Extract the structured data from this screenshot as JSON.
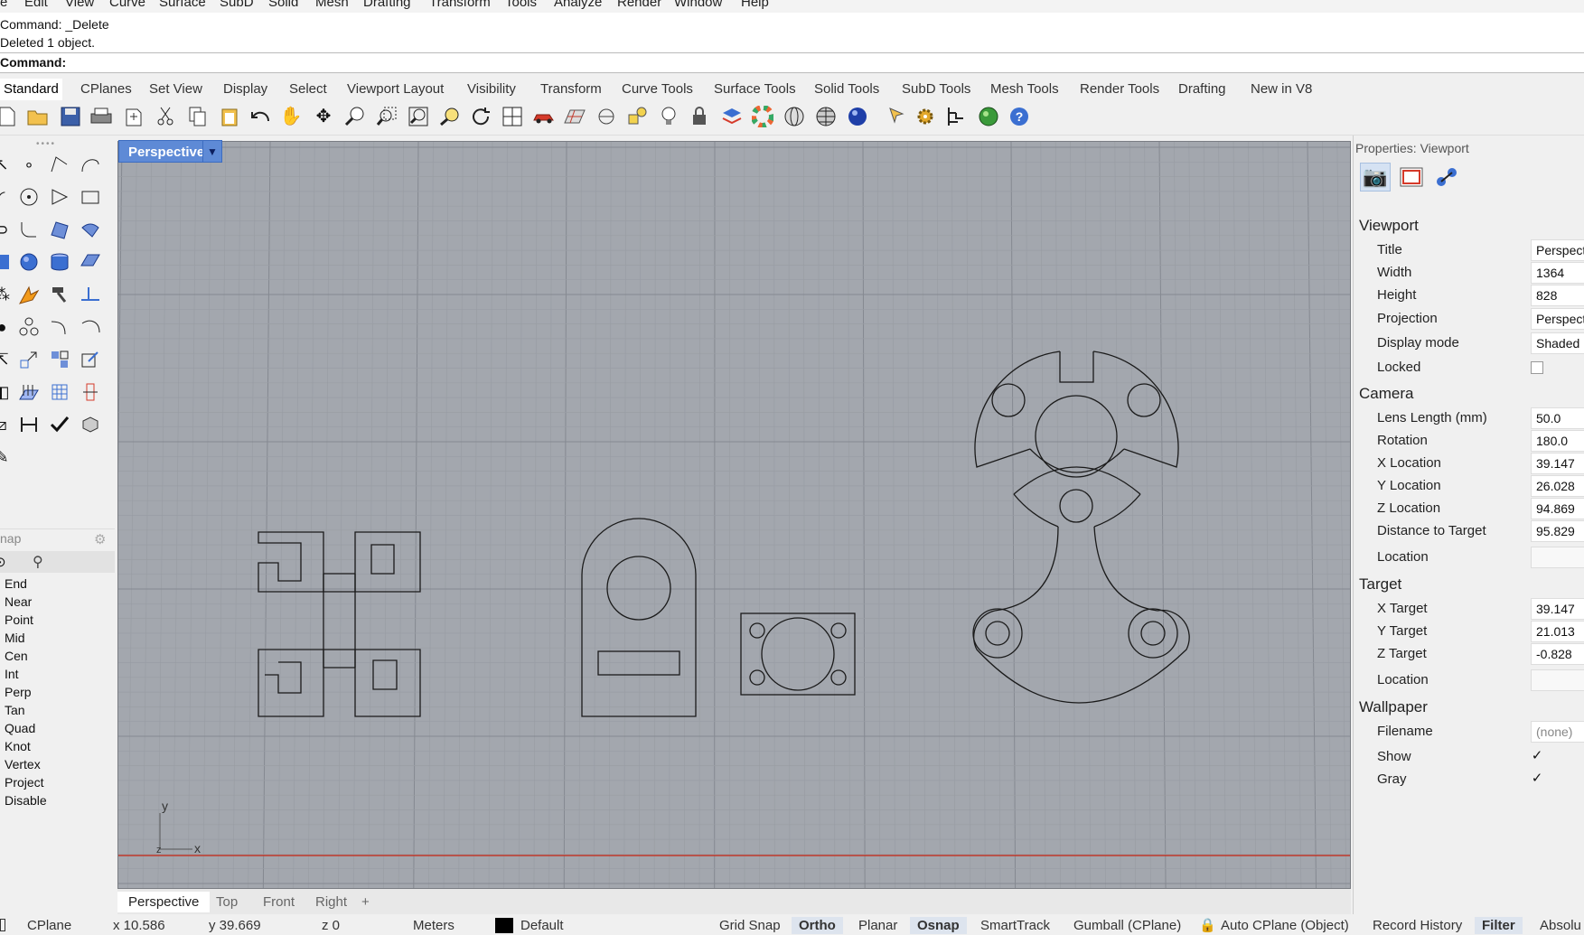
{
  "menu": [
    "e",
    "Edit",
    "View",
    "Curve",
    "Surface",
    "SubD",
    "Solid",
    "Mesh",
    "Drafting",
    "Transform",
    "Tools",
    "Analyze",
    "Render",
    "Window",
    "Help"
  ],
  "command_history": [
    "Command: _Delete",
    "Deleted 1 object."
  ],
  "command_prompt": "Command:",
  "toolbar_tabs": [
    "Standard",
    "CPlanes",
    "Set View",
    "Display",
    "Select",
    "Viewport Layout",
    "Visibility",
    "Transform",
    "Curve Tools",
    "Surface Tools",
    "Solid Tools",
    "SubD Tools",
    "Mesh Tools",
    "Render Tools",
    "Drafting",
    "New in V8"
  ],
  "toolbar_icons": [
    "new-icon",
    "open-icon",
    "save-icon",
    "print-icon",
    "import-icon",
    "cut-icon",
    "copy-icon",
    "paste-icon",
    "undo-icon",
    "pan-hand-icon",
    "move-view-icon",
    "zoom-icon",
    "zoom-window-icon",
    "zoom-extents-icon",
    "zoom-selected-icon",
    "rotate-view-icon",
    "four-viewports-icon",
    "car-icon",
    "grid-icon",
    "cplane-icon",
    "shape-icon",
    "light-icon",
    "lock-icon",
    "layer-icon",
    "color-wheel-icon",
    "sphere-wire-icon",
    "mesh-sphere-icon",
    "render-sphere-icon",
    "pointer-icon",
    "gear-icon",
    "tree-icon",
    "globe-icon",
    "help-icon"
  ],
  "osnap": {
    "title": "nap",
    "items": [
      "End",
      "Near",
      "Point",
      "Mid",
      "Cen",
      "Int",
      "Perp",
      "Tan",
      "Quad",
      "Knot",
      "Vertex",
      "Project",
      "Disable"
    ]
  },
  "viewport": {
    "label": "Perspective",
    "axis_x": "x",
    "axis_y": "y",
    "axis_z": "z"
  },
  "viewport_tabs": [
    "Perspective",
    "Top",
    "Front",
    "Right",
    "+"
  ],
  "status": {
    "cplane": "CPlane",
    "x": "x 10.586",
    "y": "y 39.669",
    "z": "z 0",
    "units": "Meters",
    "layer": "Default",
    "grid_snap": "Grid Snap",
    "ortho": "Ortho",
    "planar": "Planar",
    "osnap": "Osnap",
    "smarttrack": "SmartTrack",
    "gumball": "Gumball (CPlane)",
    "autocplane": "Auto CPlane (Object)",
    "record_history": "Record History",
    "filter": "Filter",
    "absolute": "Absolu"
  },
  "properties": {
    "title": "Properties: Viewport",
    "viewport_section": "Viewport",
    "camera_section": "Camera",
    "target_section": "Target",
    "wallpaper_section": "Wallpaper",
    "viewport": [
      {
        "label": "Title",
        "value": "Perspect"
      },
      {
        "label": "Width",
        "value": "1364"
      },
      {
        "label": "Height",
        "value": "828"
      },
      {
        "label": "Projection",
        "value": "Perspect"
      },
      {
        "label": "Display mode",
        "value": "Shaded"
      },
      {
        "label": "Locked",
        "value": ""
      }
    ],
    "camera": [
      {
        "label": "Lens Length (mm)",
        "value": "50.0"
      },
      {
        "label": "Rotation",
        "value": "180.0"
      },
      {
        "label": "X Location",
        "value": "39.147"
      },
      {
        "label": "Y Location",
        "value": "26.028"
      },
      {
        "label": "Z Location",
        "value": "94.869"
      },
      {
        "label": "Distance to Target",
        "value": "95.829"
      },
      {
        "label": "Location",
        "value": ""
      }
    ],
    "target": [
      {
        "label": "X Target",
        "value": "39.147"
      },
      {
        "label": "Y Target",
        "value": "21.013"
      },
      {
        "label": "Z Target",
        "value": "-0.828"
      },
      {
        "label": "Location",
        "value": ""
      }
    ],
    "wallpaper": [
      {
        "label": "Filename",
        "value": "(none)"
      },
      {
        "label": "Show",
        "value": "✓"
      },
      {
        "label": "Gray",
        "value": "✓"
      }
    ]
  },
  "colors": {
    "viewport_bg": "#a3a7ae",
    "viewport_label": "#5e8ad6",
    "x_axis": "#c0392b",
    "curve": "#1a1a1a"
  }
}
